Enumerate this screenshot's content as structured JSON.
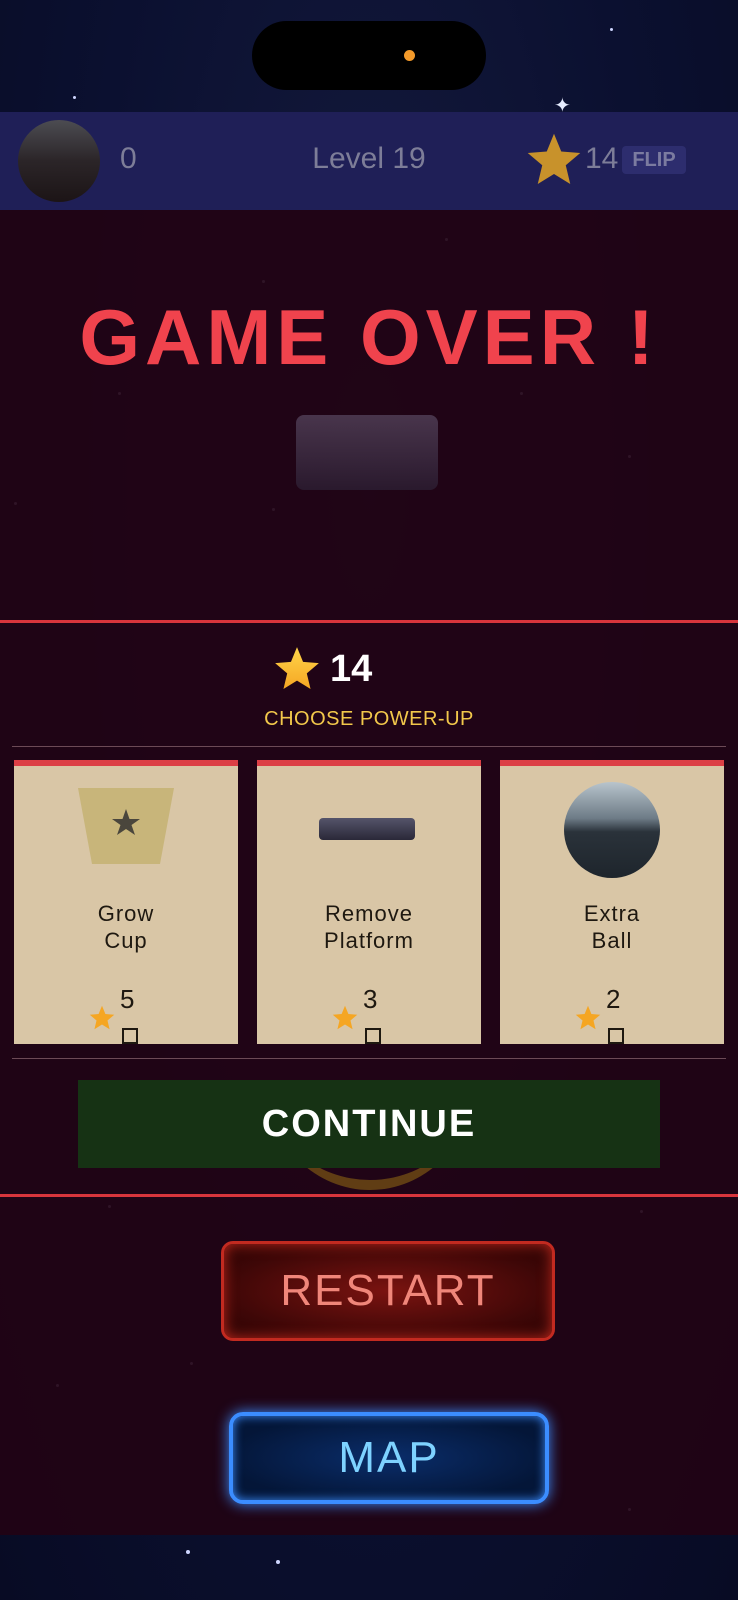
{
  "hud": {
    "score": "0",
    "level": "Level 19",
    "stars": "14",
    "flip_label": "FLIP"
  },
  "title": "GAME OVER !",
  "powerup_panel": {
    "stars_total": "14",
    "heading": "CHOOSE POWER-UP",
    "cards": [
      {
        "name_line1": "Grow",
        "name_line2": "Cup",
        "cost": "5",
        "icon": "cup-icon"
      },
      {
        "name_line1": "Remove",
        "name_line2": "Platform",
        "cost": "3",
        "icon": "platform-icon"
      },
      {
        "name_line1": "Extra",
        "name_line2": "Ball",
        "cost": "2",
        "icon": "ball-icon"
      }
    ],
    "continue_label": "CONTINUE"
  },
  "restart_label": "RESTART",
  "map_label": "MAP",
  "colors": {
    "accent_red": "#f0434d",
    "gold": "#f2c84b",
    "card_bg": "#d9c6a6",
    "continue_green": "#163214",
    "map_blue": "#3b8dff"
  }
}
